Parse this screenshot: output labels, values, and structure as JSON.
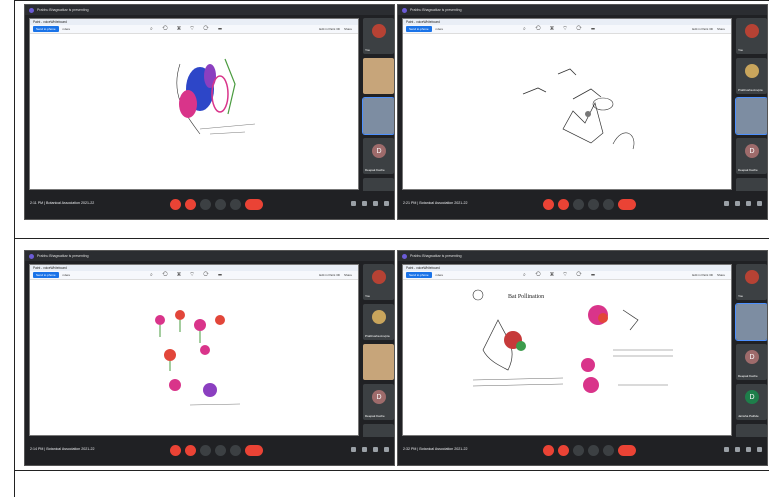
{
  "screenshots": [
    {
      "browser_title": "Prabhu Bhagwatkar is presenting",
      "app_title": "Paint - voiceWhiteboard",
      "toolbar": {
        "download": "Send to phone",
        "tab": "ndere",
        "right_1": "Edit in Paint 3D",
        "right_2": "Share"
      },
      "search": "Type here to search",
      "meeting_time": "2:11 PM | Botanical Association 2021-22",
      "participants": [
        "You",
        "",
        "",
        "Deepak Kache",
        "10 others"
      ],
      "drawing": "flower"
    },
    {
      "browser_title": "Prabhu Bhagwatkar is presenting",
      "app_title": "Paint - voiceWhiteboard",
      "toolbar": {
        "download": "Send to phone",
        "tab": "ndere",
        "right_1": "Edit in Paint 3D",
        "right_2": "Share"
      },
      "search": "Type here to search",
      "meeting_time": "2:21 PM | Botanical Association 2021-22",
      "participants": [
        "You",
        "Prabhusha Anvpta",
        "",
        "Deepak Kache",
        "10 others"
      ],
      "drawing": "birds"
    },
    {
      "browser_title": "Prabhu Bhagwatkar is presenting",
      "app_title": "Paint - voiceWhiteboard",
      "toolbar": {
        "download": "Send to phone",
        "tab": "ndere",
        "right_1": "Edit in Paint 3D",
        "right_2": "Share"
      },
      "search": "Type here to search",
      "meeting_time": "2:14 PM | Botanical Association 2021-22",
      "participants": [
        "You",
        "Prabhusha Anvpta",
        "",
        "Deepak Kache",
        "10 others"
      ],
      "drawing": "flowers-grid"
    },
    {
      "browser_title": "Prabhu Bhagwatkar is presenting",
      "app_title": "Paint - voiceWhiteboard",
      "toolbar": {
        "download": "Send to phone",
        "tab": "ndere",
        "right_1": "Edit in Paint 3D",
        "right_2": "Share"
      },
      "search": "Type here to search",
      "meeting_time": "2:32 PM | Botanical Association 2021-22",
      "participants": [
        "You",
        "",
        "Deepak Kache",
        "Jainsha Pathde",
        "15 others"
      ],
      "drawing": "bat-pollination",
      "canvas_heading": "Bat Pollination"
    }
  ],
  "colors": {
    "meet_bg": "#202124",
    "end_call": "#ea4335",
    "accent": "#1a73e8"
  }
}
